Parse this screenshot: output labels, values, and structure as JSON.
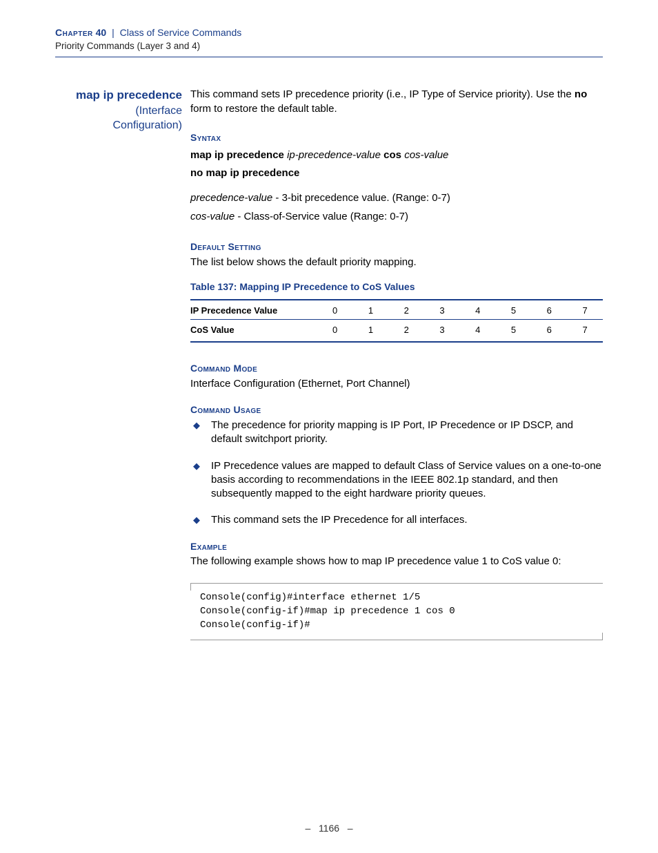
{
  "header": {
    "chapter_word": "Chapter",
    "chapter_num": "40",
    "separator": "|",
    "title": "Class of Service Commands",
    "subtitle": "Priority Commands (Layer 3 and 4)"
  },
  "sidebar": {
    "command": "map ip precedence",
    "context1": "(Interface",
    "context2": "Configuration)"
  },
  "intro": {
    "p1a": "This command sets IP precedence priority (i.e., IP Type of Service priority). Use the ",
    "p1_bold": "no",
    "p1b": " form to restore the default table."
  },
  "syntax": {
    "heading": "Syntax",
    "l1_b1": "map ip precedence",
    "l1_i1": "ip-precedence-value",
    "l1_b2": "cos",
    "l1_i2": "cos-value",
    "l2": "no map ip precedence",
    "arg1_name": "precedence-value",
    "arg1_desc": " - 3-bit precedence value. (Range: 0-7)",
    "arg2_name": "cos-value",
    "arg2_desc": " - Class-of-Service value (Range: 0-7)"
  },
  "default_setting": {
    "heading": "Default Setting",
    "text": "The list below shows the default priority mapping."
  },
  "table": {
    "caption": "Table 137: Mapping IP Precedence to CoS Values",
    "row1_label": "IP Precedence Value",
    "row2_label": "CoS Value",
    "cols": [
      "0",
      "1",
      "2",
      "3",
      "4",
      "5",
      "6",
      "7"
    ],
    "row2": [
      "0",
      "1",
      "2",
      "3",
      "4",
      "5",
      "6",
      "7"
    ]
  },
  "command_mode": {
    "heading": "Command Mode",
    "text": "Interface Configuration (Ethernet, Port Channel)"
  },
  "usage": {
    "heading": "Command Usage",
    "items": [
      "The precedence for priority mapping is IP Port, IP Precedence or IP DSCP, and default switchport priority.",
      "IP Precedence values are mapped to default Class of Service values on a one-to-one basis according to recommendations in the IEEE 802.1p standard, and then subsequently mapped to the eight hardware priority queues.",
      "This command sets the IP Precedence for all interfaces."
    ]
  },
  "example": {
    "heading": "Example",
    "text": "The following example shows how to map IP precedence value 1 to CoS value 0:",
    "code": "Console(config)#interface ethernet 1/5\nConsole(config-if)#map ip precedence 1 cos 0\nConsole(config-if)#"
  },
  "footer": {
    "page": "1166",
    "dash": "–"
  }
}
